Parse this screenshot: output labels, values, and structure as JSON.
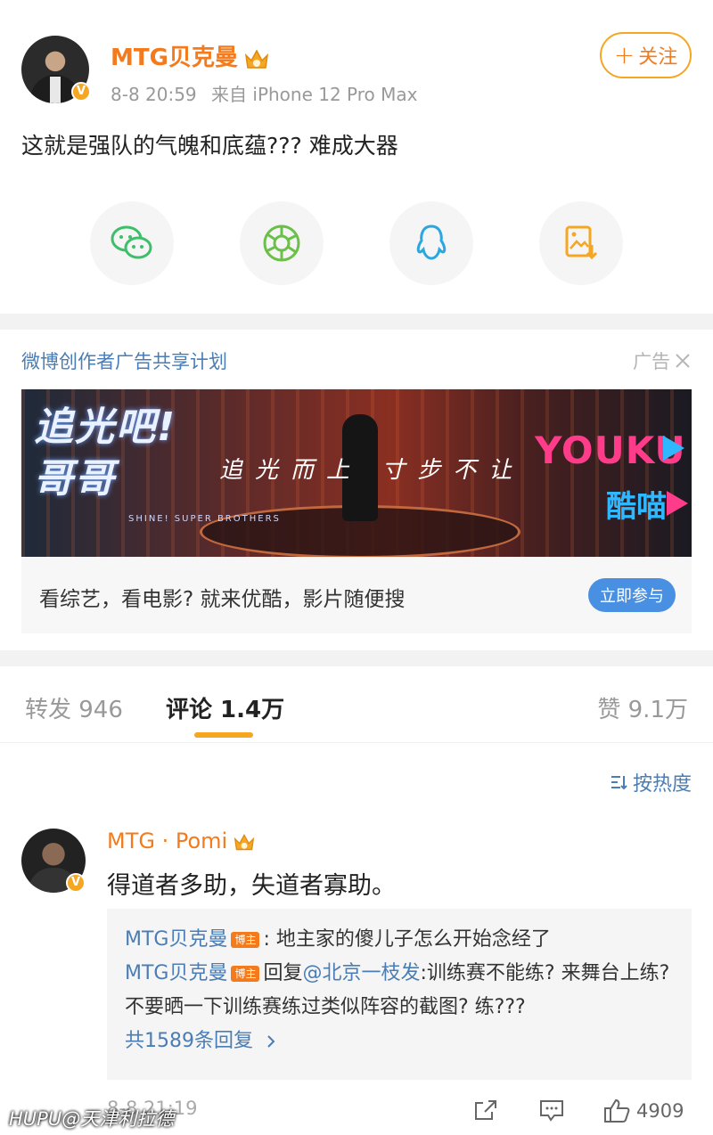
{
  "post": {
    "author": "MTG贝克曼",
    "time": "8-8 20:59",
    "source": "来自 iPhone 12 Pro Max",
    "follow_label": "关注",
    "text": "这就是强队的气魄和底蕴??? 难成大器",
    "verified_mark": "V",
    "share_icons": [
      "wechat-icon",
      "moments-icon",
      "qq-icon",
      "save-image-icon"
    ]
  },
  "ad": {
    "title": "微博创作者广告共享计划",
    "tag": "广告",
    "banner": {
      "show_name_line1": "追光吧!",
      "show_name_line2": "哥哥",
      "show_subtitle": "SHINE! SUPER BROTHERS",
      "slogan": "追光而上 寸步不让",
      "brand": "YOUKU",
      "brand2": "酷喵"
    },
    "description": "看综艺，看电影? 就来优酷，影片随便搜",
    "cta": "立即参与"
  },
  "tabs": {
    "repost": "转发 946",
    "comments": "评论 1.4万",
    "likes": "赞 9.1万"
  },
  "comments": {
    "sort_label": "按热度",
    "items": [
      {
        "author": "MTG · Pomi",
        "text": "得道者多助，失道者寡助。",
        "time": "8-8 21:19",
        "like_count": "4909",
        "replies": [
          {
            "author": "MTG贝克曼",
            "tag": "博主",
            "text": ": 地主家的傻儿子怎么开始念经了"
          },
          {
            "author": "MTG贝克曼",
            "tag": "博主",
            "prefix": "回复",
            "mention": "@北京一枝发",
            "text": ":训练赛不能练? 来舞台上练? 不要晒一下训练赛练过类似阵容的截图? 练???"
          }
        ],
        "more_replies": "共1589条回复"
      }
    ]
  },
  "watermark": "HUPU@天津利拉德",
  "colors": {
    "accent": "#f37b1d",
    "link": "#4a7db5",
    "badge": "#f5a623",
    "cta": "#4a90e2"
  }
}
